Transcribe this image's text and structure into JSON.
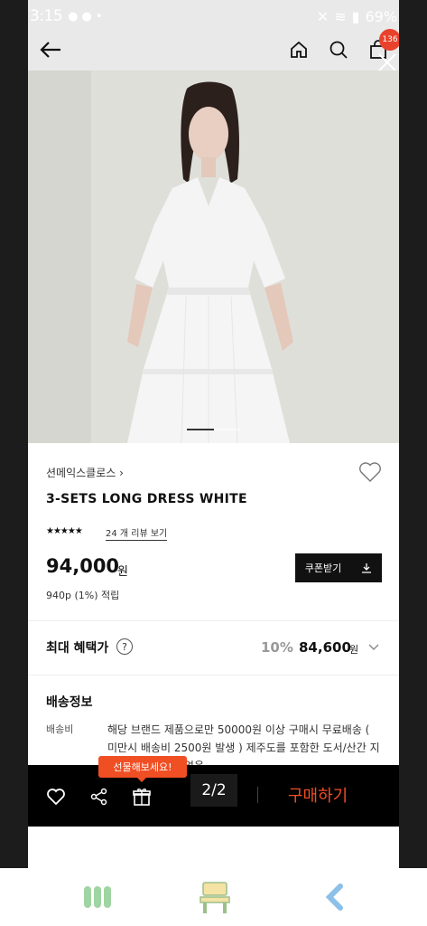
{
  "status": {
    "time": "3:15",
    "battery": "69%"
  },
  "header": {
    "cart_count": "136"
  },
  "product": {
    "brand": "션메익스클로스",
    "name": "3-SETS LONG DRESS WHITE",
    "stars": "★★★★★",
    "reviews_link": "24 개 리뷰 보기",
    "price": "94,000",
    "price_unit": "원",
    "points": "940p (1%) 적립",
    "coupon_label": "쿠폰받기"
  },
  "benefit": {
    "label": "최대 혜택가",
    "help": "?",
    "discount": "10%",
    "price": "84,600",
    "unit": "원"
  },
  "shipping": {
    "title": "배송정보",
    "label": "배송비",
    "text": "해당 브랜드 제품으로만 50000원 이상 구매시 무료배송 ( 미만시 배송비 2500원 발생 ) 제주도를 포함한 도서/산간 지역은 추가배송비 없음"
  },
  "bottom": {
    "tooltip": "선물해보세요!",
    "page_indicator": "2/2",
    "buy_label": "구매하기"
  },
  "colors": {
    "accent": "#f04e23",
    "badge": "#e8422d"
  }
}
